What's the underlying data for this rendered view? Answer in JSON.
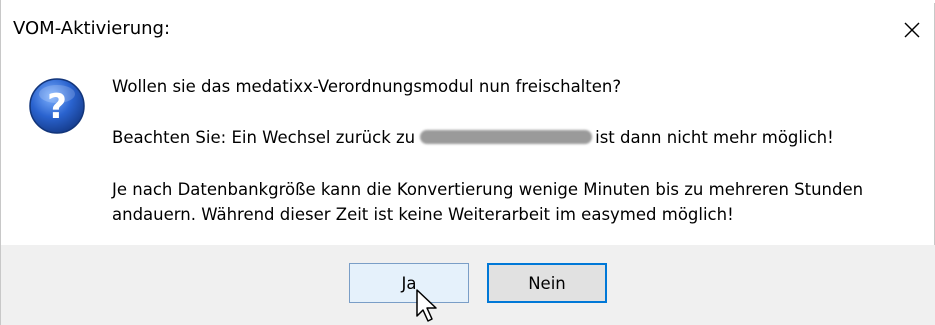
{
  "dialog": {
    "title": "VOM-Aktivierung:",
    "close_glyph": "✕",
    "icon": "question-icon"
  },
  "message": {
    "line1": "Wollen sie das medatixx-Verordnungsmodul nun freischalten?",
    "line2_before": "Beachten Sie: Ein Wechsel zurück zu",
    "line2_after": "ist dann nicht mehr möglich!",
    "line3": "Je nach Datenbankgröße kann die Konvertierung wenige Minuten bis zu mehreren Stunden",
    "line4": "andauern. Während dieser Zeit ist keine Weiterarbeit im easymed möglich!"
  },
  "buttons": {
    "yes_label": "Ja",
    "no_label": "Nein"
  },
  "colors": {
    "footer_bg": "#f0f0f0",
    "focus_border": "#0078d7",
    "icon_blue": "#1a4fa8"
  }
}
